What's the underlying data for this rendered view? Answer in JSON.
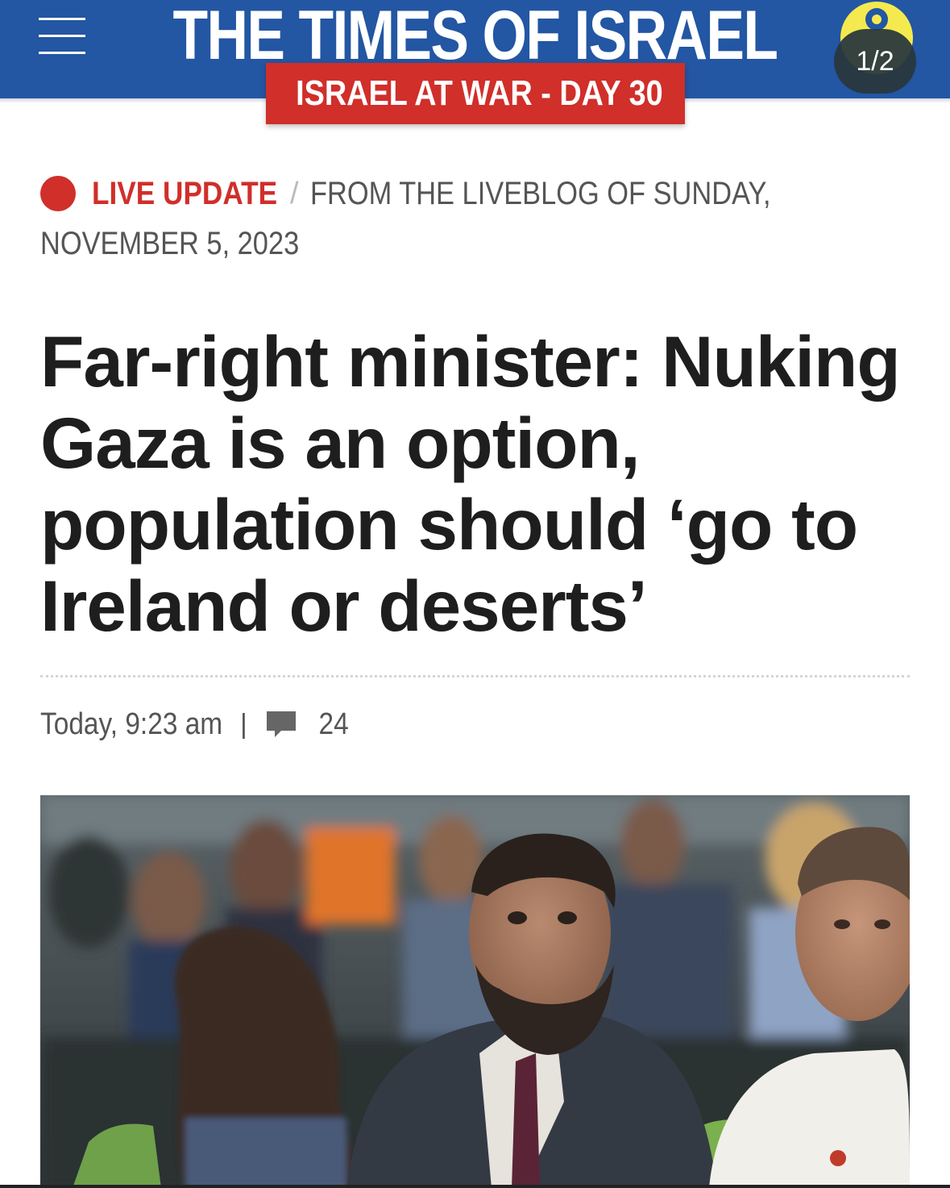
{
  "header": {
    "menu_icon": "hamburger-menu-icon",
    "logo_text": "THE TIMES OF ISRAEL",
    "banner_text": "ISRAEL AT WAR - DAY 30",
    "avatar_icon": "user-avatar-icon",
    "slide_counter": "1/2",
    "colors": {
      "bar": "#2356a3",
      "banner": "#d02f2a",
      "avatar": "#f4ea4f"
    }
  },
  "article": {
    "live_label": "LIVE UPDATE",
    "separator": "/",
    "liveblog_label": "FROM THE LIVEBLOG OF SUNDAY,",
    "liveblog_date": "NOVEMBER 5, 2023",
    "headline": "Far-right minister: Nuking Gaza is an option, population should ‘go to Ireland or deserts’",
    "timestamp": "Today, 9:23 am",
    "meta_separator": "|",
    "comment_icon": "comment-bubble-icon",
    "comment_count": "24"
  }
}
